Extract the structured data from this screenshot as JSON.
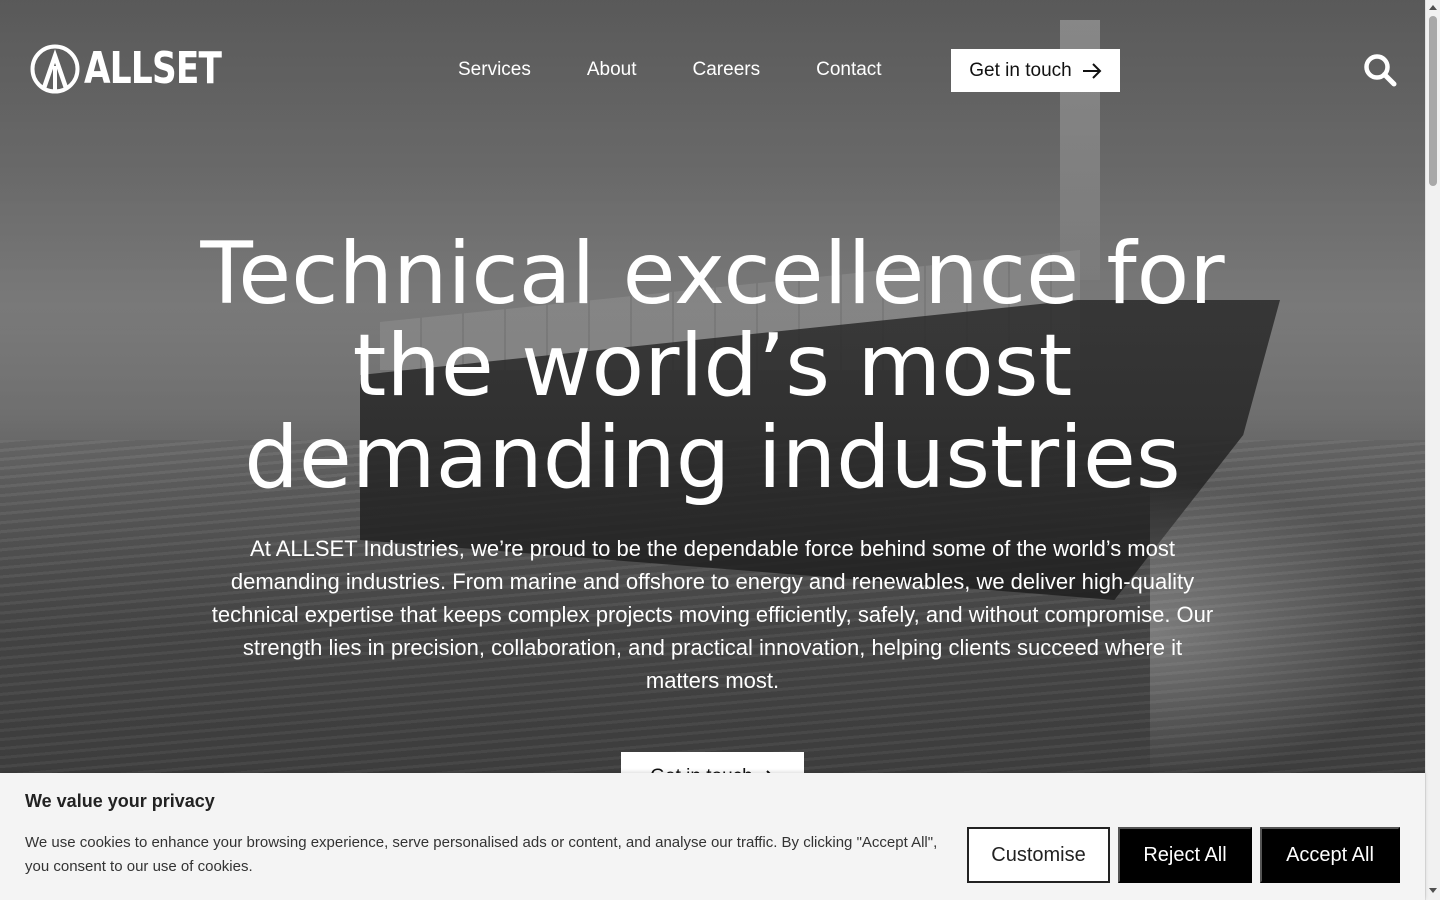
{
  "brand": {
    "name": "ALLSET"
  },
  "nav": {
    "items": [
      {
        "label": "Services"
      },
      {
        "label": "About"
      },
      {
        "label": "Careers"
      },
      {
        "label": "Contact"
      }
    ],
    "cta_label": "Get in touch",
    "cta_icon": "arrow-right-icon",
    "search_icon": "search-icon"
  },
  "hero": {
    "title_lines": [
      "Technical excellence for",
      "the world’s most",
      "demanding industries"
    ],
    "body": "At ALLSET Industries, we’re proud to be the dependable force behind some of the world’s most demanding industries. From marine and offshore to energy and renewables, we deliver high-quality technical expertise that keeps complex projects moving efficiently, safely, and without compromise. Our strength lies in precision, collaboration, and practical innovation, helping clients succeed where it matters most.",
    "cta_label": "Get in touch",
    "cta_icon": "arrow-right-icon"
  },
  "cookie": {
    "title": "We value your privacy",
    "text": "We use cookies to enhance your browsing experience, serve personalised ads or content, and analyse our traffic. By clicking \"Accept All\", you consent to our use of cookies.",
    "customise_label": "Customise",
    "reject_label": "Reject All",
    "accept_label": "Accept All"
  },
  "colors": {
    "cta_bg": "#ffffff",
    "cookie_bg": "#f4f4f4",
    "dark_button": "#000000"
  }
}
